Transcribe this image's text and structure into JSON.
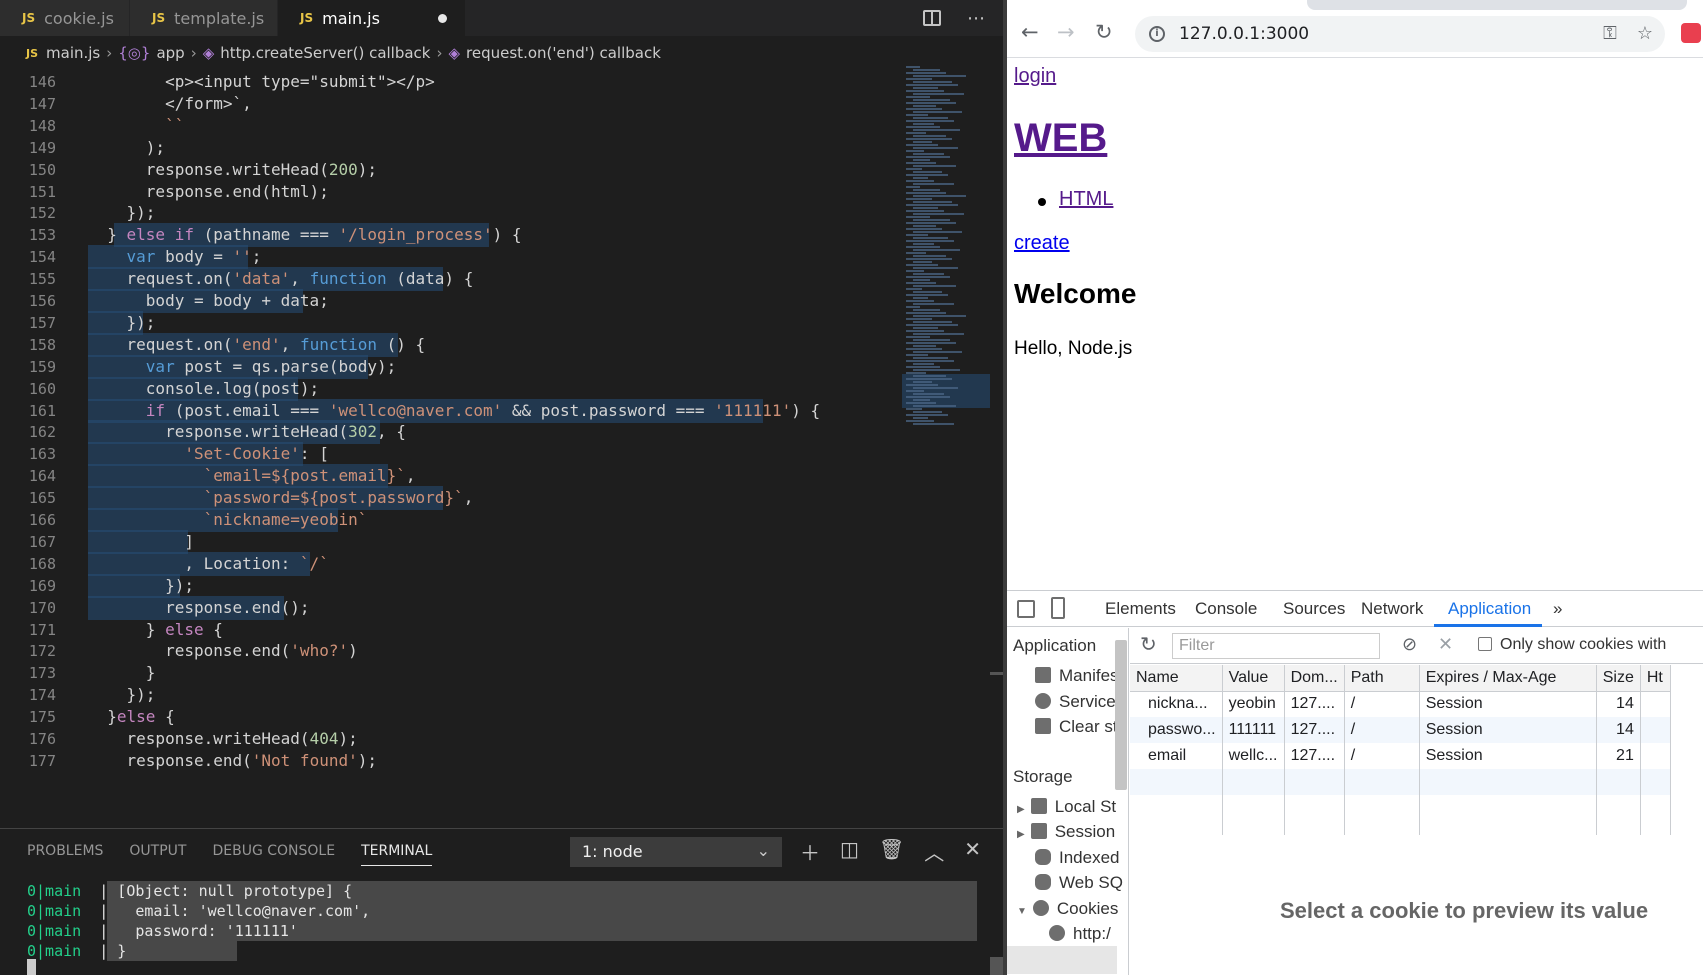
{
  "editor": {
    "tabs": [
      {
        "badge": "JS",
        "label": "cookie.js"
      },
      {
        "badge": "JS",
        "label": "template.js"
      },
      {
        "badge": "JS",
        "label": "main.js"
      }
    ],
    "breadcrumb": {
      "file": "main.js",
      "items": [
        "app",
        "http.createServer() callback",
        "request.on('end') callback"
      ]
    },
    "lines": [
      {
        "n": "146",
        "text": "        <p><input type=\"submit\"></p>"
      },
      {
        "n": "147",
        "text": "        </form>`,"
      },
      {
        "n": "148",
        "text": "        ``"
      },
      {
        "n": "149",
        "text": "      );"
      },
      {
        "n": "150",
        "text": "      response.writeHead(200);"
      },
      {
        "n": "151",
        "text": "      response.end(html);"
      },
      {
        "n": "152",
        "text": "    });"
      },
      {
        "n": "153",
        "text": "  } else if (pathname === '/login_process') {"
      },
      {
        "n": "154",
        "text": "    var body = '';"
      },
      {
        "n": "155",
        "text": "    request.on('data', function (data) {"
      },
      {
        "n": "156",
        "text": "      body = body + data;"
      },
      {
        "n": "157",
        "text": "    });"
      },
      {
        "n": "158",
        "text": "    request.on('end', function () {"
      },
      {
        "n": "159",
        "text": "      var post = qs.parse(body);"
      },
      {
        "n": "160",
        "text": "      console.log(post);"
      },
      {
        "n": "161",
        "text": "      if (post.email === 'wellco@naver.com' && post.password === '111111') {"
      },
      {
        "n": "162",
        "text": "        response.writeHead(302, {"
      },
      {
        "n": "163",
        "text": "          'Set-Cookie': ["
      },
      {
        "n": "164",
        "text": "            `email=${post.email}`,"
      },
      {
        "n": "165",
        "text": "            `password=${post.password}`,"
      },
      {
        "n": "166",
        "text": "            `nickname=yeobin`"
      },
      {
        "n": "167",
        "text": "          ]"
      },
      {
        "n": "168",
        "text": "          , Location: `/`"
      },
      {
        "n": "169",
        "text": "        });"
      },
      {
        "n": "170",
        "text": "        response.end();"
      },
      {
        "n": "171",
        "text": "      } else {"
      },
      {
        "n": "172",
        "text": "        response.end('who?')"
      },
      {
        "n": "173",
        "text": "      }"
      },
      {
        "n": "174",
        "text": "    });"
      },
      {
        "n": "175",
        "text": "  }else {"
      },
      {
        "n": "176",
        "text": "    response.writeHead(404);"
      },
      {
        "n": "177",
        "text": "    response.end('Not found');"
      }
    ],
    "panel": {
      "tabs": [
        "PROBLEMS",
        "OUTPUT",
        "DEBUG CONSOLE",
        "TERMINAL"
      ],
      "terminal_select": "1: node",
      "terminal_lines": [
        {
          "prefix": "0|main",
          "text": "  | [Object: null prototype] {"
        },
        {
          "prefix": "0|main",
          "text": "  |   email: 'wellco@naver.com',"
        },
        {
          "prefix": "0|main",
          "text": "  |   password: '111111'"
        },
        {
          "prefix": "0|main",
          "text": "  | }"
        }
      ]
    }
  },
  "browser": {
    "url": "127.0.0.1:3000",
    "page": {
      "login_link": "login",
      "title_link": "WEB",
      "list_items": [
        "HTML"
      ],
      "create_link": "create",
      "heading": "Welcome",
      "body": "Hello, Node.js"
    },
    "devtools": {
      "tabs": [
        "Elements",
        "Console",
        "Sources",
        "Network",
        "Application"
      ],
      "more": "»",
      "sidebar": {
        "application_header": "Application",
        "application_items": [
          "Manifes",
          "Service '",
          "Clear st"
        ],
        "storage_header": "Storage",
        "storage_items": [
          "Local St",
          "Session",
          "Indexed",
          "Web SQ",
          "Cookies",
          "http:/"
        ]
      },
      "filter_placeholder": "Filter",
      "only_show_label": "Only show cookies with",
      "columns": [
        "Name",
        "Value",
        "Dom...",
        "Path",
        "Expires / Max-Age",
        "Size",
        "Ht"
      ],
      "rows": [
        [
          "nickna...",
          "yeobin",
          "127....",
          "/",
          "Session",
          "14"
        ],
        [
          "passwo...",
          "111111",
          "127....",
          "/",
          "Session",
          "14"
        ],
        [
          "email",
          "wellc...",
          "127....",
          "/",
          "Session",
          "21"
        ]
      ],
      "preview_message": "Select a cookie to preview its value"
    }
  },
  "colors": {
    "editor_bg": "#1e1e1e",
    "selection": "#264f78",
    "keyword": "#569cd6",
    "string": "#ce9178",
    "devtools_accent": "#1a73e8",
    "link": "#0000ee",
    "visited_link": "#551a8b"
  }
}
